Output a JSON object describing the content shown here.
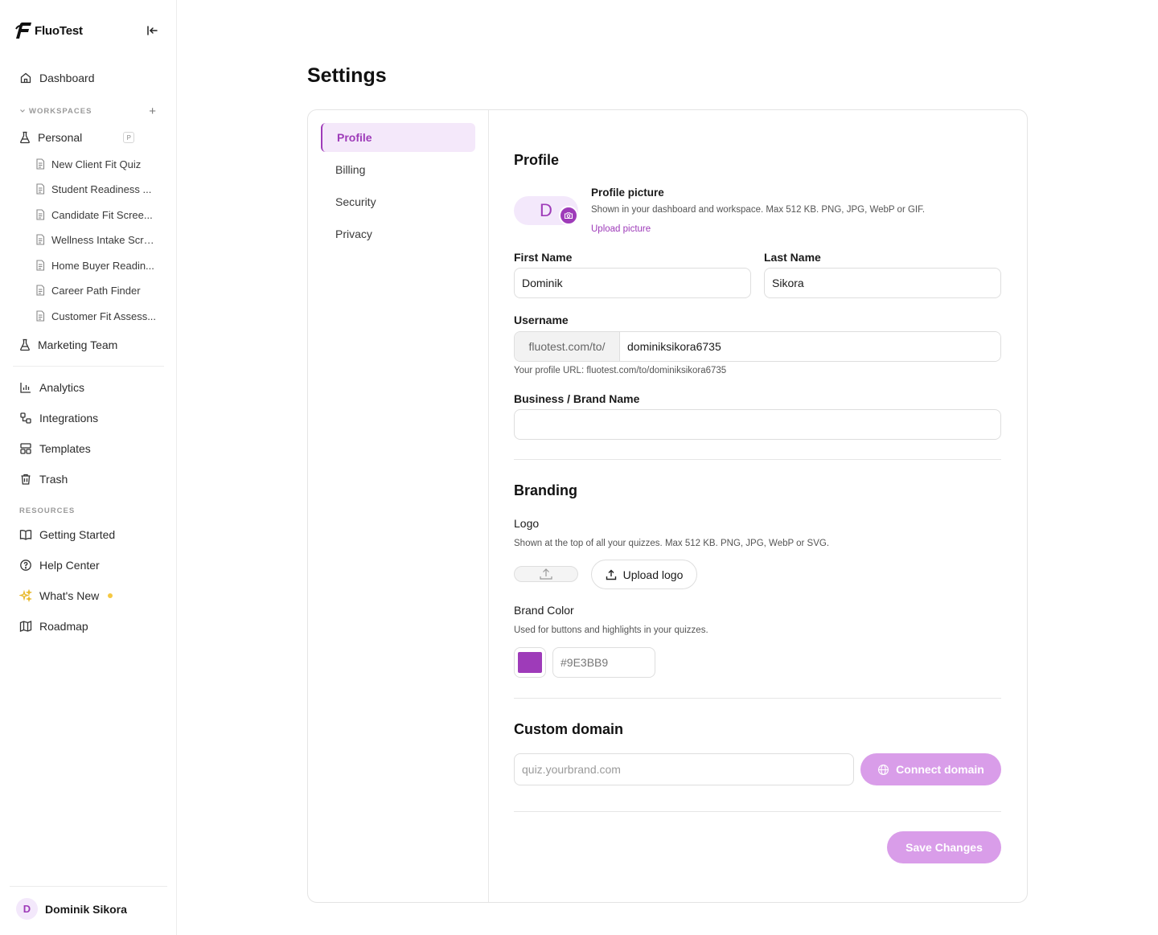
{
  "app": {
    "name": "FluoTest"
  },
  "sidebar": {
    "dashboard": "Dashboard",
    "workspaces_label": "WORKSPACES",
    "personal": {
      "label": "Personal",
      "badge": "P"
    },
    "quizzes": [
      "New Client Fit Quiz",
      "Student Readiness ...",
      "Candidate Fit Scree...",
      "Wellness Intake Scre...",
      "Home Buyer Readin...",
      "Career Path Finder",
      "Customer Fit Assess..."
    ],
    "marketing_team": "Marketing Team",
    "analytics": "Analytics",
    "integrations": "Integrations",
    "templates": "Templates",
    "trash": "Trash",
    "resources_label": "RESOURCES",
    "getting_started": "Getting Started",
    "help_center": "Help Center",
    "whats_new": "What's New",
    "roadmap": "Roadmap",
    "user": {
      "initial": "D",
      "name": "Dominik Sikora"
    }
  },
  "page": {
    "title": "Settings"
  },
  "tabs": [
    "Profile",
    "Billing",
    "Security",
    "Privacy"
  ],
  "profile": {
    "heading": "Profile",
    "avatar_initial": "D",
    "picture_title": "Profile picture",
    "picture_hint": "Shown in your dashboard and workspace. Max 512 KB. PNG, JPG, WebP or GIF.",
    "upload_picture": "Upload picture",
    "first_name_label": "First Name",
    "first_name": "Dominik",
    "last_name_label": "Last Name",
    "last_name": "Sikora",
    "username_label": "Username",
    "username_prefix": "fluotest.com/to/",
    "username": "dominiksikora6735",
    "profile_url": "Your profile URL: fluotest.com/to/dominiksikora6735",
    "brand_name_label": "Business / Brand Name",
    "brand_name": ""
  },
  "branding": {
    "heading": "Branding",
    "logo_label": "Logo",
    "logo_hint": "Shown at the top of all your quizzes. Max 512 KB. PNG, JPG, WebP or SVG.",
    "upload_logo": "Upload logo",
    "color_label": "Brand Color",
    "color_hint": "Used for buttons and highlights in your quizzes.",
    "color_value": "#9E3BB9"
  },
  "custom_domain": {
    "heading": "Custom domain",
    "placeholder": "quiz.yourbrand.com",
    "connect_label": "Connect domain"
  },
  "save_label": "Save Changes",
  "colors": {
    "accent": "#9e3bb9",
    "accent_soft": "#d99de9",
    "accent_bg": "#f4e8fa"
  }
}
